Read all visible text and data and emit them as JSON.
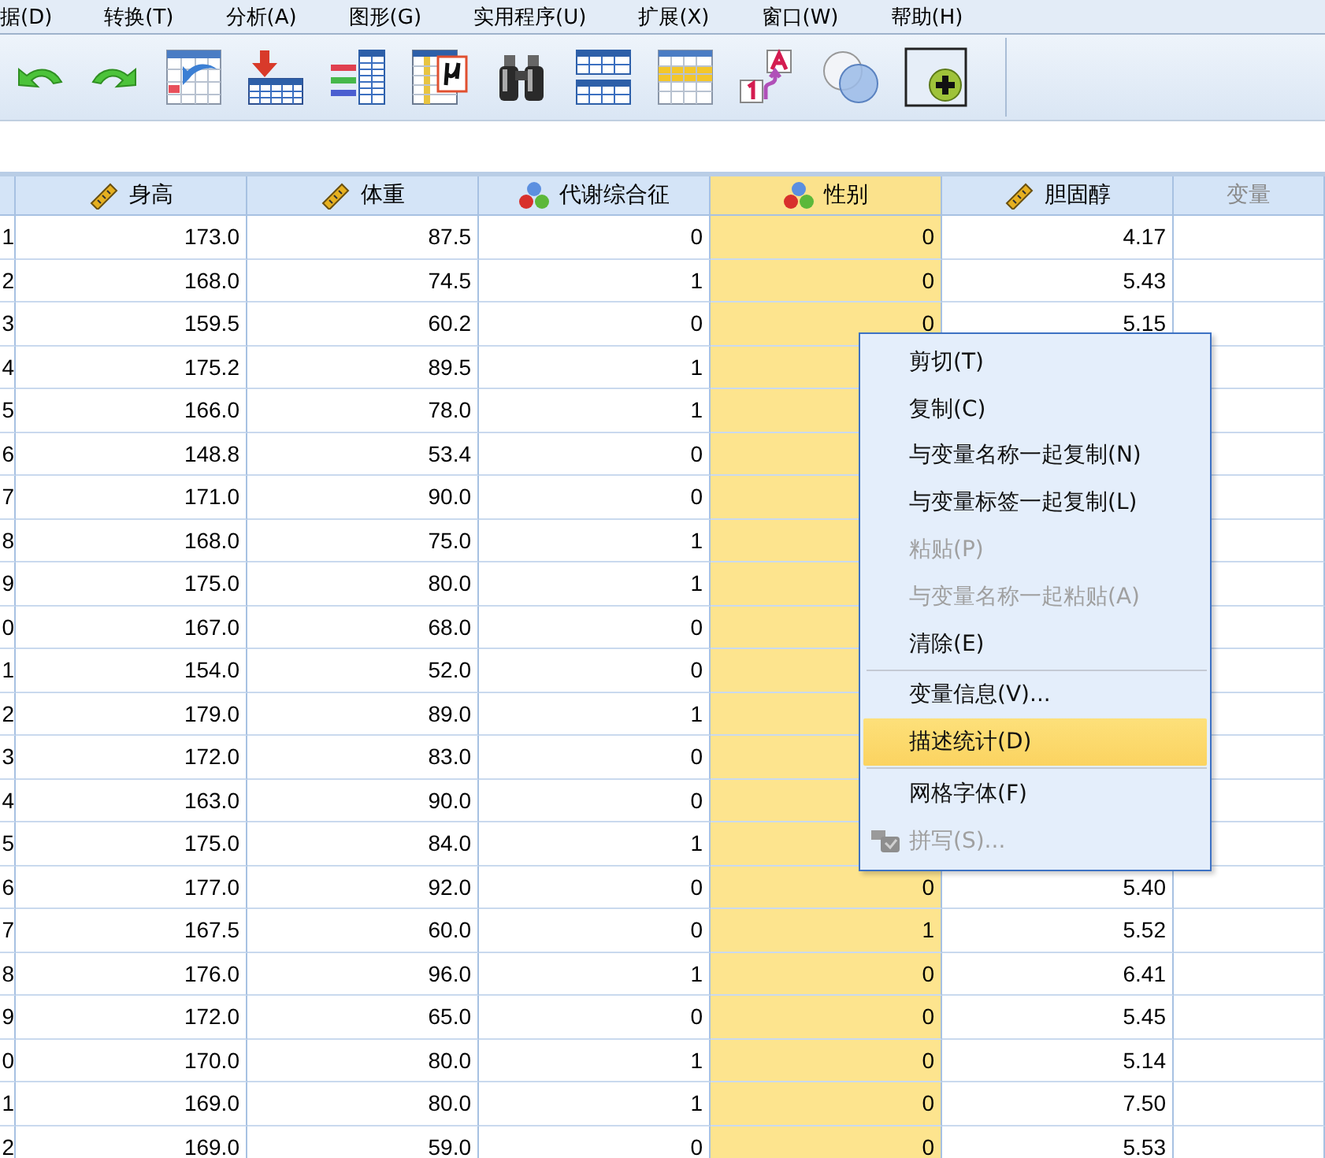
{
  "menu_bar": [
    "据(D)",
    "转换(T)",
    "分析(A)",
    "图形(G)",
    "实用程序(U)",
    "扩展(X)",
    "窗口(W)",
    "帮助(H)"
  ],
  "toolbar": [
    {
      "kind": "undo"
    },
    {
      "kind": "redo"
    },
    {
      "kind": "goto-case"
    },
    {
      "kind": "insert-case"
    },
    {
      "kind": "variables"
    },
    {
      "kind": "value-labels"
    },
    {
      "kind": "find"
    },
    {
      "kind": "split"
    },
    {
      "kind": "select"
    },
    {
      "kind": "labels"
    },
    {
      "kind": "sets"
    },
    {
      "kind": "add"
    }
  ],
  "grid": {
    "columns": [
      {
        "name": "身高",
        "kind": "scale",
        "selected": false
      },
      {
        "name": "体重",
        "kind": "scale",
        "selected": false
      },
      {
        "name": "代谢综合征",
        "kind": "nominal",
        "selected": false
      },
      {
        "name": "性别",
        "kind": "nominal",
        "selected": true
      },
      {
        "name": "胆固醇",
        "kind": "scale",
        "selected": false
      },
      {
        "name": "变量",
        "kind": "empty",
        "selected": false
      }
    ],
    "rows": [
      [
        "1",
        "173.0",
        "87.5",
        "0",
        "0",
        "4.17"
      ],
      [
        "2",
        "168.0",
        "74.5",
        "1",
        "0",
        "5.43"
      ],
      [
        "3",
        "159.5",
        "60.2",
        "0",
        "0",
        "5.15"
      ],
      [
        "4",
        "175.2",
        "89.5",
        "1"
      ],
      [
        "5",
        "166.0",
        "78.0",
        "1"
      ],
      [
        "6",
        "148.8",
        "53.4",
        "0"
      ],
      [
        "7",
        "171.0",
        "90.0",
        "0"
      ],
      [
        "8",
        "168.0",
        "75.0",
        "1"
      ],
      [
        "9",
        "175.0",
        "80.0",
        "1"
      ],
      [
        "0",
        "167.0",
        "68.0",
        "0"
      ],
      [
        "1",
        "154.0",
        "52.0",
        "0"
      ],
      [
        "2",
        "179.0",
        "89.0",
        "1"
      ],
      [
        "3",
        "172.0",
        "83.0",
        "0"
      ],
      [
        "4",
        "163.0",
        "90.0",
        "0"
      ],
      [
        "5",
        "175.0",
        "84.0",
        "1"
      ],
      [
        "6",
        "177.0",
        "92.0",
        "0",
        "0",
        "5.40"
      ],
      [
        "7",
        "167.5",
        "60.0",
        "0",
        "1",
        "5.52"
      ],
      [
        "8",
        "176.0",
        "96.0",
        "1",
        "0",
        "6.41"
      ],
      [
        "9",
        "172.0",
        "65.0",
        "0",
        "0",
        "5.45"
      ],
      [
        "0",
        "170.0",
        "80.0",
        "1",
        "0",
        "5.14"
      ],
      [
        "1",
        "169.0",
        "80.0",
        "1",
        "0",
        "7.50"
      ],
      [
        "2",
        "169.0",
        "59.0",
        "0",
        "0",
        "5.53"
      ]
    ]
  },
  "context_menu": [
    {
      "kind": "item",
      "label": "剪切(T)",
      "disabled": false,
      "selected": false
    },
    {
      "kind": "item",
      "label": "复制(C)",
      "disabled": false,
      "selected": false
    },
    {
      "kind": "item",
      "label": "与变量名称一起复制(N)",
      "disabled": false,
      "selected": false
    },
    {
      "kind": "item",
      "label": "与变量标签一起复制(L)",
      "disabled": false,
      "selected": false
    },
    {
      "kind": "item",
      "label": "粘贴(P)",
      "disabled": true,
      "selected": false
    },
    {
      "kind": "item",
      "label": "与变量名称一起粘贴(A)",
      "disabled": true,
      "selected": false
    },
    {
      "kind": "item",
      "label": "清除(E)",
      "disabled": false,
      "selected": false
    },
    {
      "kind": "separator"
    },
    {
      "kind": "item",
      "label": "变量信息(V)...",
      "disabled": false,
      "selected": false
    },
    {
      "kind": "item",
      "label": "描述统计(D)",
      "disabled": false,
      "selected": true
    },
    {
      "kind": "separator"
    },
    {
      "kind": "item",
      "label": "网格字体(F)",
      "disabled": false,
      "selected": false
    },
    {
      "kind": "icon-item",
      "label": "拼写(S)...",
      "disabled": true,
      "selected": false
    }
  ]
}
